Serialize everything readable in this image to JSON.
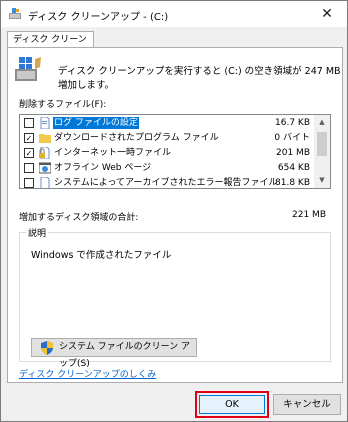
{
  "window": {
    "title": "ディスク クリーンアップ - (C:)",
    "close_glyph": "✕"
  },
  "tab": {
    "label": "ディスク クリーンアップ"
  },
  "intro": {
    "text": "ディスク クリーンアップを実行すると (C:) の空き領域が 247 MB 増加します。"
  },
  "files": {
    "label": "削除するファイル(F):",
    "items": [
      {
        "name": "ログ ファイルの設定",
        "size": "16.7 KB",
        "checked": false,
        "selected": true,
        "icon": "document-icon"
      },
      {
        "name": "ダウンロードされたプログラム ファイル",
        "size": "0 バイト",
        "checked": true,
        "selected": false,
        "icon": "folder-icon"
      },
      {
        "name": "インターネット一時ファイル",
        "size": "201 MB",
        "checked": true,
        "selected": false,
        "icon": "lock-document-icon"
      },
      {
        "name": "オフライン Web ページ",
        "size": "654 KB",
        "checked": false,
        "selected": false,
        "icon": "web-page-icon"
      },
      {
        "name": "システムによってアーカイブされたエラー報告ファイル",
        "size": "81.8 KB",
        "checked": false,
        "selected": false,
        "icon": "document-icon"
      }
    ]
  },
  "total": {
    "label": "増加するディスク領域の合計:",
    "value": "221 MB"
  },
  "description": {
    "title": "説明",
    "text": "Windows で作成されたファイル"
  },
  "buttons": {
    "cleanup_system": "システム ファイルのクリーン アップ(S)",
    "ok": "OK",
    "cancel": "キャンセル"
  },
  "link": {
    "how_it_works": "ディスク クリーンアップのしくみ"
  },
  "colors": {
    "highlight": "#e0001a",
    "selection": "#0078d7",
    "link": "#0066cc"
  }
}
